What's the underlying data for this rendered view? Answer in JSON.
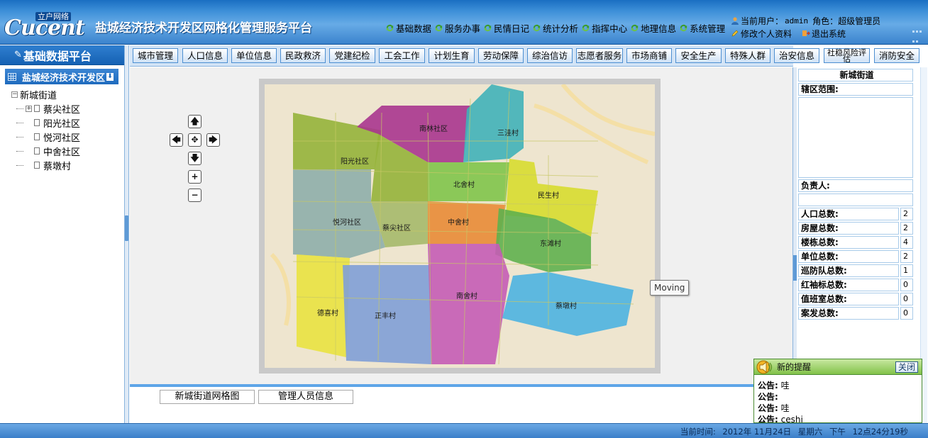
{
  "header": {
    "brand_small": "立户网络",
    "brand": "Cucent",
    "title": "盐城经济技术开发区网格化管理服务平台",
    "nav": [
      "基础数据",
      "服务办事",
      "民情日记",
      "统计分析",
      "指挥中心",
      "地理信息",
      "系统管理"
    ],
    "user_label": "当前用户：",
    "user_name": "admin",
    "role_label": "角色：",
    "role_name": "超级管理员",
    "edit_profile": "修改个人资料",
    "logout": "退出系统"
  },
  "sidebar": {
    "title": "基础数据平台",
    "zone": "盐城经济技术开发区",
    "tree_root": "新城街道",
    "tree_items": [
      "蔡尖社区",
      "阳光社区",
      "悦河社区",
      "中舍社区",
      "蔡墩村"
    ]
  },
  "tabs": [
    "城市管理",
    "人口信息",
    "单位信息",
    "民政救济",
    "党建纪检",
    "工会工作",
    "计划生育",
    "劳动保障",
    "综治信访",
    "志愿者服务",
    "市场商铺",
    "安全生产",
    "特殊人群",
    "治安信息",
    "社稳风险评估",
    "消防安全"
  ],
  "map": {
    "regions": [
      "南林社区",
      "三洼村",
      "阳光社区",
      "北舍村",
      "民生村",
      "悦河社区",
      "蔡尖社区",
      "中舍村",
      "东滩村",
      "德喜村",
      "正丰村",
      "南舍村",
      "蔡墩村"
    ],
    "tooltip": "Moving",
    "colors": {
      "olive": "#95b23a",
      "magenta": "#a8358e",
      "teal": "#40b1b8",
      "green": "#80c44a",
      "yellow": "#d7dc2f",
      "slate": "#8eaeaa",
      "orange": "#e88d3b",
      "emerald": "#5fb04e",
      "lemon": "#e9e240",
      "cornflower": "#7f9fd6",
      "orchid": "#c45cb5",
      "sky": "#4db2e0"
    }
  },
  "bottom_tabs": [
    "新城街道网格图",
    "管理人员信息"
  ],
  "info": {
    "title": "新城街道",
    "area_label": "辖区范围:",
    "leader_label": "负责人:",
    "stats": [
      {
        "label": "人口总数:",
        "value": "2"
      },
      {
        "label": "房屋总数:",
        "value": "2"
      },
      {
        "label": "楼栋总数:",
        "value": "4"
      },
      {
        "label": "单位总数:",
        "value": "2"
      },
      {
        "label": "巡防队总数:",
        "value": "1"
      },
      {
        "label": "红袖标总数:",
        "value": "0"
      },
      {
        "label": "值班室总数:",
        "value": "0"
      },
      {
        "label": "案发总数:",
        "value": "0"
      }
    ]
  },
  "notify": {
    "title": "新的提醒",
    "close": "关闭",
    "items": [
      {
        "label": "公告:",
        "text": "哇"
      },
      {
        "label": "公告:",
        "text": ""
      },
      {
        "label": "公告:",
        "text": "哇"
      },
      {
        "label": "公告:",
        "text": "ceshi"
      }
    ]
  },
  "status": {
    "label": "当前时间:",
    "date": "2012年 11月24日",
    "weekday": "星期六",
    "ampm": "下午",
    "time": "12点24分19秒"
  }
}
